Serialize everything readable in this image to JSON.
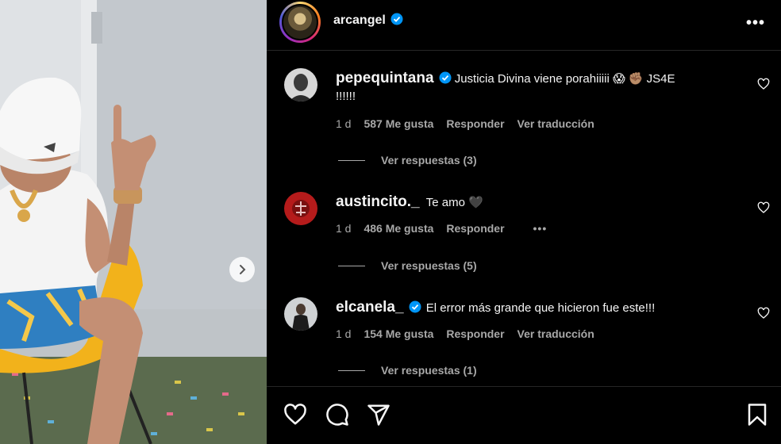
{
  "post": {
    "username": "arcangel",
    "verified": true
  },
  "header": {
    "more_icon": "more-horizontal-icon",
    "more_label": "•••"
  },
  "comments": [
    {
      "username": "pepequintana",
      "verified": true,
      "text_line1": "Justicia Divina viene porahiiiii 😱 ✊🏽 JS4E",
      "text_line2": "!!!!!!",
      "time": "1 d",
      "likes": "587 Me gusta",
      "reply": "Responder",
      "translate": "Ver traducción",
      "replies": "Ver respuestas (3)"
    },
    {
      "username": "austincito._",
      "verified": false,
      "text_line1": "Te amo 🖤",
      "time": "1 d",
      "likes": "486 Me gusta",
      "reply": "Responder",
      "more": "•••",
      "replies": "Ver respuestas (5)"
    },
    {
      "username": "elcanela_",
      "verified": true,
      "text_line1": "El error más grande que hicieron fue este!!!",
      "time": "1 d",
      "likes": "154 Me gusta",
      "reply": "Responder",
      "translate": "Ver traducción",
      "replies": "Ver respuestas (1)"
    }
  ],
  "actions": [
    "heart-icon",
    "comment-icon",
    "share-icon",
    "bookmark-icon"
  ],
  "colors": {
    "background": "#000000",
    "text": "#f5f5f5",
    "muted": "#a8a8a8",
    "verified": "#0095f6"
  }
}
